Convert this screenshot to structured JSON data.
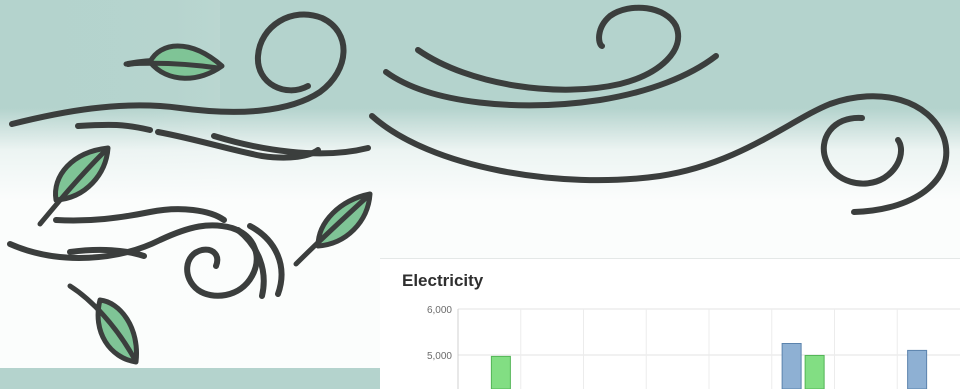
{
  "colors": {
    "background": "#b4d3cd",
    "line_art": "#3b3e3d",
    "leaf_fill": "#7fc496",
    "bar_blue": "#8eb0d3",
    "bar_green": "#82de83"
  },
  "decoration": {
    "icons": [
      "wind-swirl-icon",
      "leaf-icon"
    ]
  },
  "chart": {
    "title": "Electricity"
  },
  "chart_data": {
    "type": "bar",
    "title": "Electricity",
    "ylim": [
      4400,
      6000
    ],
    "yticks": [
      "6,000",
      "5,000"
    ],
    "ytick_values": [
      6000,
      5000
    ],
    "grid": true,
    "series": [
      {
        "values": [
          null,
          null,
          null,
          null,
          null,
          5250,
          null,
          5100
        ]
      },
      {
        "values": [
          4970,
          null,
          null,
          null,
          null,
          4990,
          null,
          null
        ]
      }
    ],
    "categories_count": 8
  }
}
